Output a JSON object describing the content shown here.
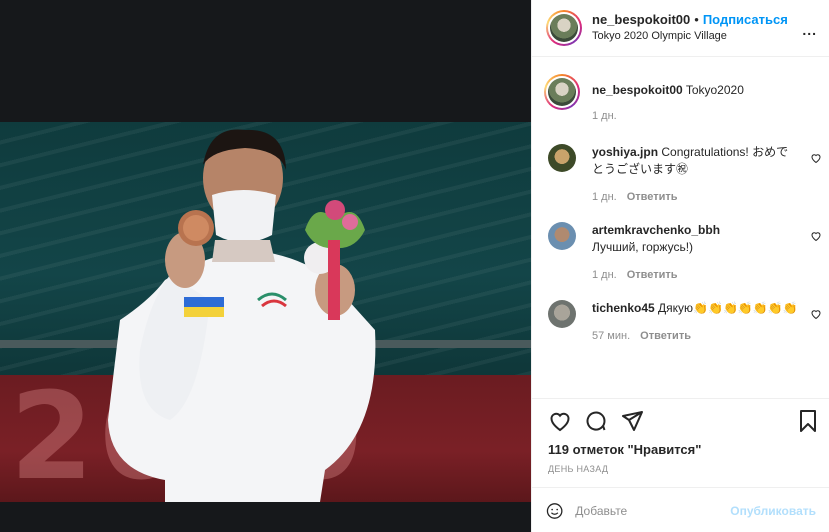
{
  "post": {
    "header": {
      "username": "ne_bespokoit00",
      "separator": "•",
      "follow_label": "Подписаться",
      "location": "Tokyo 2020 Olympic Village",
      "more_label": "..."
    },
    "caption": {
      "username": "ne_bespokoit00",
      "text": "Tokyo2020",
      "time": "1 дн."
    },
    "comments": [
      {
        "username": "yoshiya.jpn",
        "text": "Congratulations! おめでとうございます㊗",
        "time": "1 дн.",
        "reply_label": "Ответить"
      },
      {
        "username": "artemkravchenko_bbh",
        "text": "Лучший, горжусь!)",
        "time": "1 дн.",
        "reply_label": "Ответить"
      },
      {
        "username": "tichenko45",
        "text": "Дякую👏👏👏👏👏👏👏",
        "time": "57 мин.",
        "reply_label": "Ответить"
      }
    ],
    "likes_text": "119 отметок \"Нравится\"",
    "date_text": "ДЕНЬ НАЗАД",
    "add_comment": {
      "placeholder": "Добавьте",
      "publish_label": "Опубликовать"
    },
    "photo": {
      "banner_text": "2020"
    }
  },
  "icons": [
    "heart-icon",
    "comment-icon",
    "share-icon",
    "bookmark-icon",
    "emoji-icon",
    "more-icon"
  ],
  "colors": {
    "accent": "#0095f6",
    "publish_disabled": "#b2dffc",
    "muted": "#8e8e8e",
    "text": "#262626"
  }
}
